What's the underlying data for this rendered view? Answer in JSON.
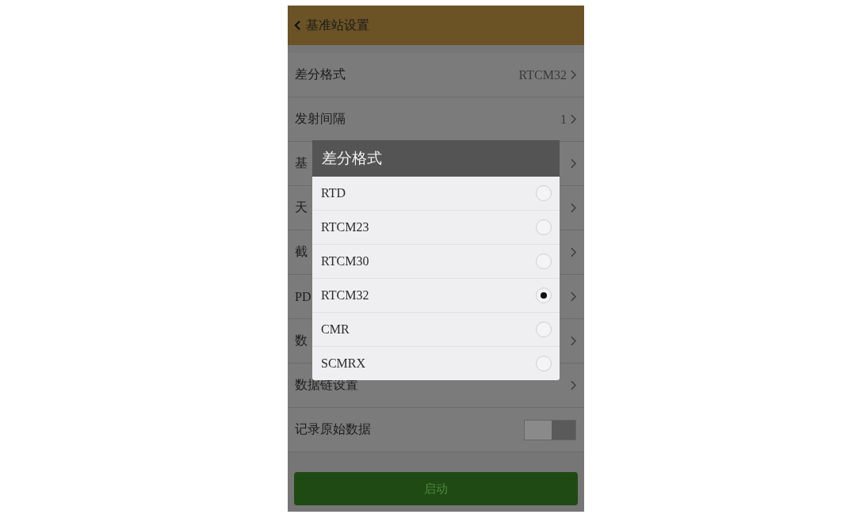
{
  "header": {
    "title": "基准站设置"
  },
  "settings": [
    {
      "kind": "link",
      "label": "差分格式",
      "value": "RTCM32"
    },
    {
      "kind": "link",
      "label": "发射间隔",
      "value": "1"
    },
    {
      "kind": "link",
      "label": "基"
    },
    {
      "kind": "link",
      "label": "天"
    },
    {
      "kind": "link",
      "label": "截"
    },
    {
      "kind": "link",
      "label": "PD"
    },
    {
      "kind": "link",
      "label": "数"
    },
    {
      "kind": "link",
      "label": "数据链设置"
    },
    {
      "kind": "toggle",
      "label": "记录原始数据",
      "on": false
    }
  ],
  "start_button": {
    "label": "启动"
  },
  "dialog": {
    "title": "差分格式",
    "options": [
      {
        "label": "RTD",
        "selected": false
      },
      {
        "label": "RTCM23",
        "selected": false
      },
      {
        "label": "RTCM30",
        "selected": false
      },
      {
        "label": "RTCM32",
        "selected": true
      },
      {
        "label": "CMR",
        "selected": false
      },
      {
        "label": "SCMRX",
        "selected": false
      }
    ]
  }
}
